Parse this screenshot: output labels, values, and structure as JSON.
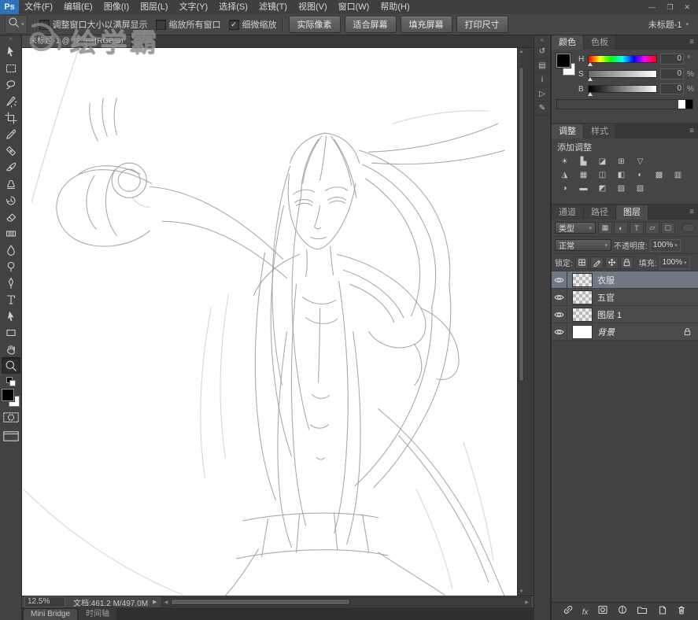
{
  "app": {
    "logo": "Ps",
    "window_controls": [
      {
        "name": "minimize-button",
        "glyph": "—"
      },
      {
        "name": "restore-button",
        "glyph": "❐"
      },
      {
        "name": "close-button",
        "glyph": "✕"
      }
    ]
  },
  "menu_items": [
    "文件(F)",
    "编辑(E)",
    "图像(I)",
    "图层(L)",
    "文字(Y)",
    "选择(S)",
    "滤镜(T)",
    "视图(V)",
    "窗口(W)",
    "帮助(H)"
  ],
  "icons": {
    "panel_menu": "≡",
    "dropdown": "▾",
    "check": "✓",
    "collapse_left": "«",
    "collapse_right": "»",
    "scroll_up": "▲",
    "scroll_down": "▼",
    "scroll_left": "◀",
    "scroll_right": "▶",
    "status_proceed": "▶",
    "fx": "fx"
  },
  "options": {
    "checkboxes": [
      {
        "label": "调整窗口大小以满屏显示",
        "checked": false
      },
      {
        "label": "缩放所有窗口",
        "checked": false
      },
      {
        "label": "细微缩放",
        "checked": true
      }
    ],
    "buttons": [
      "实际像素",
      "适合屏幕",
      "填充屏幕",
      "打印尺寸"
    ],
    "workspace": "未标题-1"
  },
  "tools": [
    {
      "name": "move-tool"
    },
    {
      "name": "marquee-tool"
    },
    {
      "name": "lasso-tool"
    },
    {
      "name": "quick-selection-tool"
    },
    {
      "name": "crop-tool"
    },
    {
      "name": "eyedropper-tool"
    },
    {
      "name": "healing-brush-tool"
    },
    {
      "name": "brush-tool"
    },
    {
      "name": "clone-stamp-tool"
    },
    {
      "name": "history-brush-tool"
    },
    {
      "name": "eraser-tool"
    },
    {
      "name": "gradient-tool"
    },
    {
      "name": "blur-tool"
    },
    {
      "name": "dodge-tool"
    },
    {
      "name": "pen-tool"
    },
    {
      "name": "type-tool"
    },
    {
      "name": "path-selection-tool"
    },
    {
      "name": "shape-tool"
    },
    {
      "name": "hand-tool"
    },
    {
      "name": "zoom-tool",
      "active": true
    }
  ],
  "collapsed_dock": {
    "icons": [
      {
        "name": "history-panel-icon",
        "glyph": "↺"
      },
      {
        "name": "navigator-panel-icon",
        "glyph": "▤"
      },
      {
        "name": "info-panel-icon",
        "glyph": "i"
      },
      {
        "name": "actions-panel-icon",
        "glyph": "▷"
      },
      {
        "name": "brush-presets-panel-icon",
        "glyph": "✎"
      }
    ]
  },
  "document": {
    "tab_label": "未标题-1 @ 12.5%(RGB/8)",
    "zoom": "12.5%",
    "info": "文档:461.2 M/497.0M"
  },
  "watermark": {
    "text": "绘学霸"
  },
  "bottom_tabs": [
    "Mini Bridge",
    "时间轴"
  ],
  "color_panel": {
    "tabs": [
      "颜色",
      "色板"
    ],
    "active_tab": "颜色",
    "sliders": [
      {
        "label": "H",
        "value": "0",
        "unit": "°"
      },
      {
        "label": "S",
        "value": "0",
        "unit": "%"
      },
      {
        "label": "B",
        "value": "0",
        "unit": "%"
      }
    ]
  },
  "adjustments_panel": {
    "tabs": [
      "调整",
      "样式"
    ],
    "active_tab": "调整",
    "title": "添加调整",
    "icon_rows": [
      [
        "☀",
        "▙",
        "◪",
        "⊞",
        "▽"
      ],
      [
        "◮",
        "▦",
        "◫",
        "◧",
        "◐",
        "▩",
        "▥"
      ],
      [
        "◑",
        "▬",
        "◩",
        "▨",
        "▧"
      ]
    ]
  },
  "layers_panel": {
    "tabs": [
      "通道",
      "路径",
      "图层"
    ],
    "active_tab": "图层",
    "filter": {
      "kind_label": "类型",
      "icons": [
        "▦",
        "◐",
        "T",
        "▱",
        "▢"
      ]
    },
    "blend_mode": "正常",
    "opacity_label": "不透明度:",
    "opacity_value": "100%",
    "lock_label": "锁定:",
    "lock_icons": [
      "lock-transparency-icon",
      "lock-pixels-icon",
      "lock-position-icon",
      "lock-all-icon"
    ],
    "fill_label": "填充:",
    "fill_value": "100%",
    "layers": [
      {
        "name": "衣服",
        "selected": true,
        "thumb": "checker",
        "locked": false,
        "visible": true
      },
      {
        "name": "五官",
        "selected": false,
        "thumb": "checker",
        "locked": false,
        "visible": true
      },
      {
        "name": "图层 1",
        "selected": false,
        "thumb": "checker",
        "locked": false,
        "visible": true
      },
      {
        "name": "背景",
        "selected": false,
        "thumb": "white",
        "locked": true,
        "italic": true,
        "visible": true
      }
    ],
    "actions": [
      "link-layers-icon",
      "layer-style-icon",
      "add-mask-icon",
      "adjustment-layer-icon",
      "new-group-icon",
      "new-layer-icon",
      "delete-layer-icon"
    ]
  },
  "sketch": {
    "stroke": "#9c9c9c",
    "paths": [
      "M339 160 C336 184 338 210 346 228 C352 241 362 252 372 255 C380 257 390 249 399 236 C410 220 420 196 423 172",
      "M344 186 C352 179 364 178 371 183",
      "M385 181 C394 175 406 175 413 181",
      "M346 196 C353 191 363 191 369 196 M348 200 C354 196 362 196 368 200",
      "M388 193 C395 188 405 188 411 193 M390 197 C396 193 404 193 410 197",
      "M378 200 C376 212 373 222 371 227 C373 230 377 230 379 228",
      "M366 240 C372 243 380 243 386 240",
      "M361 256 C362 268 362 280 360 290",
      "M391 252 C392 264 393 276 395 288",
      "M384 108 C362 112 346 126 340 146",
      "M384 108 C406 110 422 124 428 146",
      "M380 112 C368 128 360 148 356 172",
      "M376 116 C362 136 354 162 354 188",
      "M392 112 C404 128 414 150 418 174",
      "M396 116 C410 136 420 162 424 190",
      "M386 112 C384 130 382 150 378 168",
      "M428 130 C462 140 494 162 516 194 C536 224 546 262 542 300",
      "M432 148 C468 164 498 194 514 232 C526 260 528 296 520 328",
      "M436 166 C466 186 490 216 500 252 C508 280 506 312 494 340",
      "M440 132 C492 130 548 120 604 96",
      "M444 146 C500 150 556 146 612 130",
      "M542 300 C548 352 540 410 514 462 C496 498 470 534 446 558",
      "M520 328 C522 380 508 436 480 484 C462 514 440 540 422 556",
      "M340 150 C328 186 320 232 318 280 C316 330 320 382 330 428",
      "M354 188 C344 240 340 300 344 360 C347 404 354 448 364 484",
      "M332 200 C318 260 312 330 318 398 C322 442 330 484 342 518",
      "M308 260 C296 330 292 408 300 478 C304 514 312 548 322 574",
      "M331 268 C300 238 268 214 236 198 C212 186 186 178 162 176",
      "M336 292 C306 266 276 246 246 234 C224 225 200 220 178 220",
      "M164 172 C124 150 82 148 58 170 C36 190 40 226 66 242 C92 258 136 254 162 232",
      "M150 160 C120 146 90 146 72 160",
      "M92 162 C78 182 78 212 94 230",
      "M118 154 C102 178 102 214 120 238",
      "M158 168 A22 22 0 1 1 114 168 A22 22 0 1 1 158 168",
      "M150 168 A14 14 0 1 1 122 168 A14 14 0 1 1 150 168",
      "M96 118 C88 102 84 86 86 70 M108 112 C102 96 100 80 103 64 M120 110 C116 94 116 78 120 64",
      "M400 262 C442 272 484 296 506 330 C516 348 514 368 498 376 C478 386 452 378 440 360",
      "M408 282 C444 294 472 316 484 342",
      "M416 300 C444 310 464 328 472 348",
      "M352 262 C326 272 304 290 294 314",
      "M506 330 C534 342 552 366 554 392 C556 412 544 424 526 420",
      "M498 376 C510 394 510 414 498 428",
      "M348 300 C342 360 340 428 344 494 C346 536 352 576 360 606",
      "M402 296 C412 364 416 436 412 504 C410 548 404 588 396 616",
      "M356 316 C368 326 386 328 398 320",
      "M360 342 C372 352 390 352 400 344",
      "M378 330 C378 360 377 392 376 424",
      "M368 440 C374 446 384 446 390 441",
      "M366 478 C372 484 382 484 389 478",
      "M374 520 C377 523 381 523 384 520",
      "M336 360 C326 428 322 496 326 554 C328 586 334 612 342 634",
      "M420 360 C430 430 432 500 426 558 C423 586 418 610 412 630",
      "M280 600 C330 590 400 586 452 596",
      "M272 648 C330 636 408 632 464 644",
      "M312 598 L304 646 M352 592 L348 640 M396 590 L400 636 M432 592 L440 640",
      "M452 458 C508 504 556 568 588 640 C598 662 606 682 612 695",
      "M478 492 C528 546 568 612 592 678",
      "M300 636 C284 662 270 682 258 695",
      "M452 640 C482 660 512 678 536 694"
    ],
    "light_paths": [
      "M72 0 C52 60 30 130 12 196",
      "M240 330 C226 402 222 478 232 546",
      "M262 312 C250 380 248 454 258 520",
      "M560 500 C576 548 590 600 598 650",
      "M470 96 C510 84 552 78 592 80",
      "M2 560 C58 616 130 664 204 694",
      "M500 560 C520 600 536 644 546 686",
      "M140 190 C146 198 154 202 162 202"
    ]
  }
}
